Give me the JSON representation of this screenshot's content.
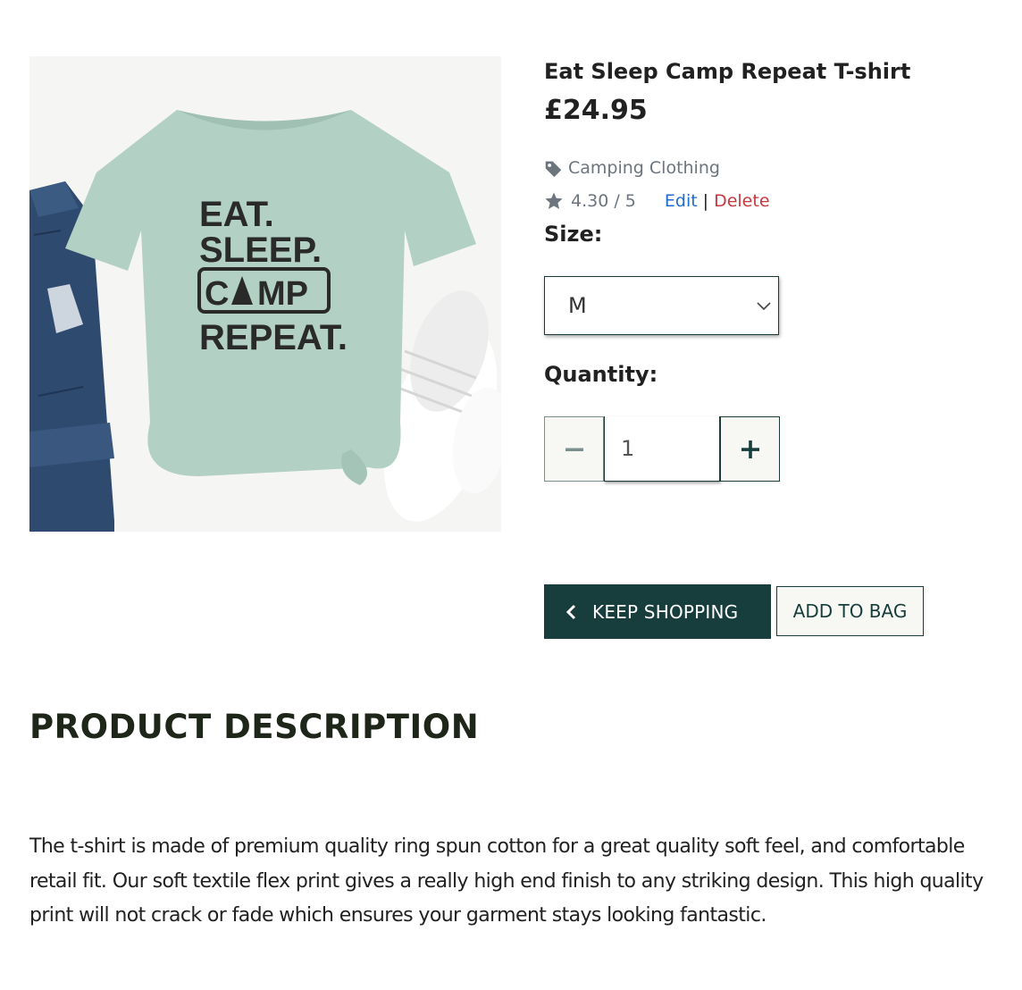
{
  "product": {
    "name": "Eat Sleep Camp Repeat T-shirt",
    "price": "£24.95",
    "category": "Camping Clothing",
    "rating": "4.30 / 5",
    "admin": {
      "edit_label": "Edit",
      "separator": "|",
      "delete_label": "Delete"
    },
    "image": {
      "shirt_print": [
        "EAT.",
        "SLEEP.",
        "C",
        "MP",
        "REPEAT."
      ],
      "shirt_color": "#b2d0c4"
    }
  },
  "size": {
    "label": "Size:",
    "selected": "M"
  },
  "quantity": {
    "label": "Quantity:",
    "value": "1"
  },
  "buttons": {
    "keep_shopping": "KEEP SHOPPING",
    "add_to_bag": "ADD TO BAG"
  },
  "description": {
    "heading": "PRODUCT DESCRIPTION",
    "text": "The t-shirt is made of premium quality ring spun cotton for a great quality soft feel, and comfortable retail fit. Our soft textile flex print gives a really high end finish to any striking design. This high quality print will not crack or fade which ensures your garment stays looking fantastic."
  },
  "colors": {
    "brand_dark": "#173d3c",
    "edit_link": "#1c6dd0",
    "delete_link": "#c7383f",
    "muted_text": "#6c757d"
  },
  "icons": {
    "category": "tag-icon",
    "rating": "star-icon",
    "size_dropdown": "chevron-down-icon",
    "decrement": "minus-icon",
    "increment": "plus-icon",
    "back": "chevron-left-icon"
  }
}
